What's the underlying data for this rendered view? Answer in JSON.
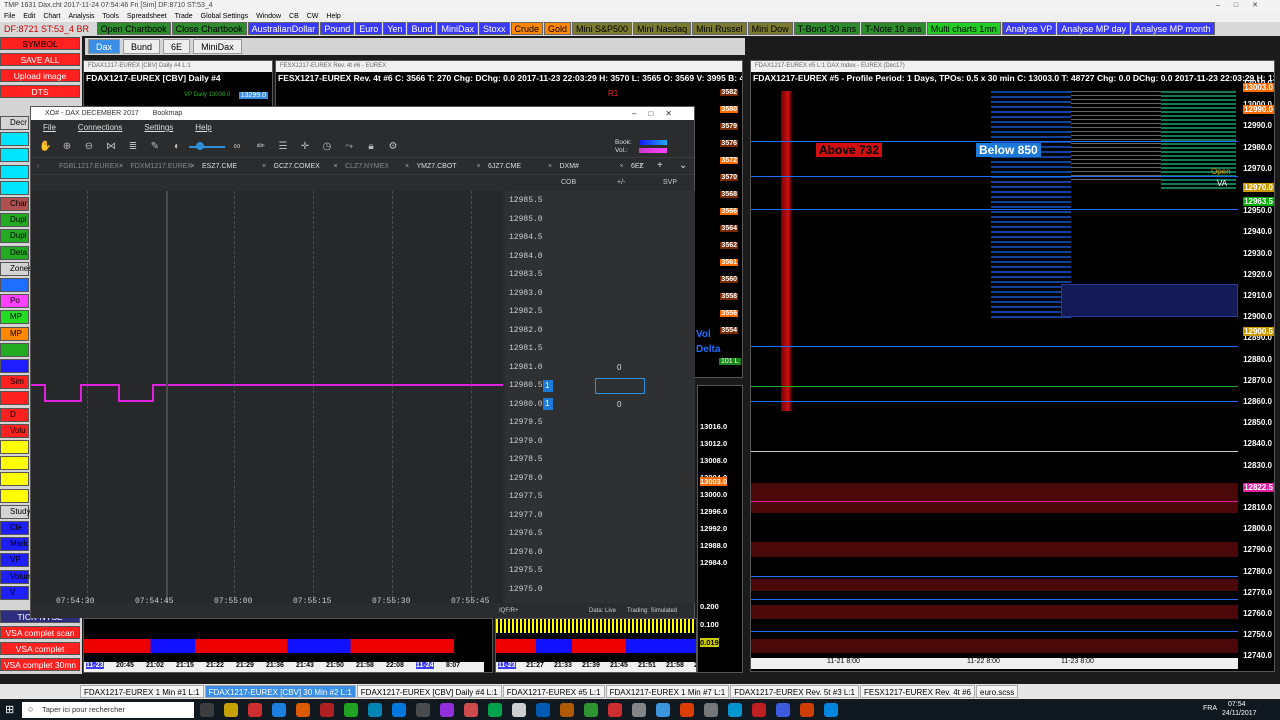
{
  "window": {
    "title": "TMP 1631 Dax.cht  2017-11-24  07:54:46 Fri [Sim]  DF:8710  ST:53_4"
  },
  "menu": [
    "File",
    "Edit",
    "Chart",
    "Analysis",
    "Tools",
    "Spreadsheet",
    "Trade",
    "Global Settings",
    "Window",
    "CB",
    "CW",
    "Help"
  ],
  "status": "DF:8721  ST:53_4  BR",
  "toolbar": [
    {
      "label": "Open Chartbook",
      "bg": "#2e8b2e",
      "fg": "#000"
    },
    {
      "label": "Close Chartbook",
      "bg": "#2e8b2e",
      "fg": "#000"
    },
    {
      "label": "AustralianDollar",
      "bg": "#3a3aff",
      "fg": "#fff"
    },
    {
      "label": "Pound",
      "bg": "#3a3aff",
      "fg": "#fff"
    },
    {
      "label": "Euro",
      "bg": "#3a3aff",
      "fg": "#fff"
    },
    {
      "label": "Yen",
      "bg": "#3a3aff",
      "fg": "#fff"
    },
    {
      "label": "Bund",
      "bg": "#3a3aff",
      "fg": "#fff"
    },
    {
      "label": "MiniDax",
      "bg": "#3a3aff",
      "fg": "#fff"
    },
    {
      "label": "Stoxx",
      "bg": "#3a3aff",
      "fg": "#fff"
    },
    {
      "label": "Crude",
      "bg": "#ff8800",
      "fg": "#000"
    },
    {
      "label": "Gold",
      "bg": "#ff8800",
      "fg": "#000"
    },
    {
      "label": "Mini S&P500",
      "bg": "#7a7a30",
      "fg": "#000"
    },
    {
      "label": "Mini Nasdaq",
      "bg": "#7a7a30",
      "fg": "#000"
    },
    {
      "label": "Mini Russel",
      "bg": "#7a7a30",
      "fg": "#000"
    },
    {
      "label": "Mini Dow",
      "bg": "#7a7a30",
      "fg": "#000"
    },
    {
      "label": "T-Bond 30 ans",
      "bg": "#2e8b2e",
      "fg": "#000"
    },
    {
      "label": "T-Note 10 ans",
      "bg": "#2e8b2e",
      "fg": "#000"
    },
    {
      "label": "Multi charts 1mn",
      "bg": "#22cc22",
      "fg": "#000"
    },
    {
      "label": "Analyse VP",
      "bg": "#3a3aff",
      "fg": "#fff"
    },
    {
      "label": "Analyse MP day",
      "bg": "#3a3aff",
      "fg": "#fff"
    },
    {
      "label": "Analyse MP month",
      "bg": "#3a3aff",
      "fg": "#fff"
    }
  ],
  "sheets": [
    {
      "label": "Dax",
      "selected": true
    },
    {
      "label": "Bund"
    },
    {
      "label": "6E"
    },
    {
      "label": "MiniDax"
    }
  ],
  "left_buttons": [
    {
      "label": "SYMBOL",
      "bg": "#ff2020",
      "fg": "#000"
    },
    {
      "label": "SAVE ALL",
      "bg": "#ff2020",
      "fg": "#fff"
    },
    {
      "label": "Upload image",
      "bg": "#ff2020",
      "fg": "#fff"
    },
    {
      "label": "DTS",
      "bg": "#ff2020",
      "fg": "#fff"
    }
  ],
  "left_strips": [
    {
      "label": "Decr",
      "bg": "#d4d4d4"
    },
    {
      "label": "",
      "bg": "#00e5ff"
    },
    {
      "label": "",
      "bg": "#00e5ff"
    },
    {
      "label": "",
      "bg": "#00e5ff"
    },
    {
      "label": "",
      "bg": "#00e5ff"
    },
    {
      "label": "Char",
      "bg": "#b05050"
    },
    {
      "label": "Dupl",
      "bg": "#22aa22"
    },
    {
      "label": "Dupl",
      "bg": "#22aa22"
    },
    {
      "label": "Deta",
      "bg": "#22aa22"
    },
    {
      "label": "Zones",
      "bg": "#d4d4d4"
    },
    {
      "label": "",
      "bg": "#1e6eff"
    },
    {
      "label": "Po",
      "bg": "#ff40ff"
    },
    {
      "label": "MP",
      "bg": "#22dd22"
    },
    {
      "label": "MP",
      "bg": "#ff8800"
    },
    {
      "label": "",
      "bg": "#22aa22"
    },
    {
      "label": "",
      "bg": "#1e1eff"
    },
    {
      "label": "Sim",
      "bg": "#ff2020"
    },
    {
      "label": "",
      "bg": "#ff2020"
    },
    {
      "label": "D",
      "bg": "#ff2020"
    },
    {
      "label": "Volu",
      "bg": "#ff2020"
    },
    {
      "label": "",
      "bg": "#ffff00"
    },
    {
      "label": "",
      "bg": "#ffff00"
    },
    {
      "label": "",
      "bg": "#ffff00"
    },
    {
      "label": "",
      "bg": "#ffff00"
    },
    {
      "label": "Study",
      "bg": "#d4d4d4"
    },
    {
      "label": "Cle",
      "bg": "#1e1eff"
    },
    {
      "label": "Mark",
      "bg": "#1e1eff"
    },
    {
      "label": "VP",
      "bg": "#1e1eff"
    },
    {
      "label": "Volum",
      "bg": "#1e1eff"
    },
    {
      "label": "V",
      "bg": "#1e1eff"
    }
  ],
  "left_bottom": [
    {
      "label": "TICK-NYSE",
      "bg": "#2e2e80",
      "fg": "#fff"
    },
    {
      "label": "VSA complet scan",
      "bg": "#ff2020",
      "fg": "#fff"
    },
    {
      "label": "VSA complet",
      "bg": "#ff2020",
      "fg": "#fff"
    },
    {
      "label": "VSA complet 30mn",
      "bg": "#ff2020",
      "fg": "#fff"
    }
  ],
  "chart_daily": {
    "title": "FDAX1217-EUREX [CBV]  Daily  #4",
    "tag": "13299.0",
    "vp": "VP Daily 13008.0"
  },
  "chart_fesx": {
    "title": "FESX1217-EUREX  Rev. 4t  #6",
    "values": "C: 3566  T: 270  Chg:  DChg: 0.0  2017-11-23 22:03:29  H: 3570  L: 3565  O: 3569  V: 3995  B: 4",
    "r1": "R1",
    "prices": [
      "3582",
      "3580",
      "3579",
      "3576",
      "3572",
      "3570",
      "3568",
      "3566",
      "3564",
      "3562",
      "3561",
      "3560",
      "3558",
      "3556",
      "3554"
    ],
    "footer": "Delta",
    "vol": "Vol",
    "bid_vol": "101 L"
  },
  "chart_profile": {
    "title": "FDAX1217-EUREX #5 - Profile Period: 1 Days, TPOs: 0.5 x 30 min",
    "values": "C: 13003.0  T: 48727  Chg: 0.0  DChg: 0.0  2017-11-23 22:03:29  H: 13",
    "above": "Above 732",
    "below": "Below 850",
    "open": "Open",
    "va": "VA",
    "prices": [
      "13010.0",
      "13000.0",
      "12990.0",
      "12980.0",
      "12970.0",
      "12960.0",
      "12950.0",
      "12940.0",
      "12930.0",
      "12920.0",
      "12910.0",
      "12900.0",
      "12890.0",
      "12880.0",
      "12870.0",
      "12860.0",
      "12850.0",
      "12840.0",
      "12830.0",
      "12820.0",
      "12810.0",
      "12800.0",
      "12790.0",
      "12780.0",
      "12770.0",
      "12760.0",
      "12750.0",
      "12740.0"
    ],
    "tags": [
      "13003.0",
      "12990.0",
      "12970.0",
      "12963.5",
      "12900.5",
      "12822.5"
    ],
    "dates": [
      "11-21  8:00",
      "11-22  8:00",
      "11-23  8:00"
    ]
  },
  "chart_1min": {
    "prices": [
      "13016.0",
      "13012.0",
      "13008.0",
      "13004.0",
      "13000.0",
      "12996.0",
      "12992.0",
      "12988.0",
      "12984.0"
    ],
    "tag": "13003.0",
    "osc": [
      "0.200",
      "0.100",
      "0.019"
    ]
  },
  "chart_30min": {
    "dates": [
      "11-23",
      "20:45",
      "21:02",
      "21:15",
      "21:22",
      "21:29",
      "21:36",
      "21:43",
      "21:50",
      "21:58",
      "22:08",
      "11-24",
      "8:07"
    ]
  },
  "chart_fesx_dates": [
    "11-23",
    "21:27",
    "21:33",
    "21:39",
    "21:45",
    "21:51",
    "21:58",
    "22:07"
  ],
  "bookmap": {
    "title": "XO# - DAX DECEMBER 2017",
    "subtitle": "Bookmap",
    "menu": [
      "File",
      "Connections",
      "Settings",
      "Help"
    ],
    "tabs": [
      "FGBL1217.EUREX",
      "FDXM1217.EUREX",
      "ESZ7.CME",
      "GCZ7.COMEX",
      "CLZ7.NYMEX",
      "YMZ7.CBOT",
      "6JZ7.CME",
      "DXM#",
      "6EZ"
    ],
    "book_label": "Book:",
    "vol_label": "Vol.:",
    "cols": [
      "COB",
      "+/-",
      "SVP"
    ],
    "prices": [
      "12985.5",
      "12985.0",
      "12984.5",
      "12984.0",
      "12983.5",
      "12983.0",
      "12982.5",
      "12982.0",
      "12981.5",
      "12981.0",
      "12980.5",
      "12980.0",
      "12979.5",
      "12979.0",
      "12978.5",
      "12978.0",
      "12977.5",
      "12977.0",
      "12976.5",
      "12976.0",
      "12975.5",
      "12975.0"
    ],
    "bid_qty": "1",
    "ask_qty": "1",
    "plus_top": "0",
    "plus_bot": "0",
    "times": [
      "07:54:30",
      "07:54:45",
      "07:55:00",
      "07:55:15",
      "07:55:30",
      "07:55:45"
    ],
    "footer_left": "IQF/R+",
    "data": "Data: Live",
    "trading": "Trading: Simulated"
  },
  "taskbar_tabs": [
    {
      "label": "FDAX1217-EUREX  1 Min  #1  L:1"
    },
    {
      "label": "FDAX1217-EUREX [CBV]  30 Min  #2  L:1",
      "selected": true
    },
    {
      "label": "FDAX1217-EUREX [CBV]  Daily  #4  L:1"
    },
    {
      "label": "FDAX1217-EUREX  #5  L:1"
    },
    {
      "label": "FDAX1217-EUREX  1 Min  #7  L:1"
    },
    {
      "label": "FDAX1217-EUREX  Rev. 5t  #3  L:1"
    },
    {
      "label": "FESX1217-EUREX  Rev. 4t  #6"
    },
    {
      "label": "euro.scss"
    }
  ],
  "windows": {
    "search": "Taper ici pour rechercher",
    "lang": "FRA",
    "time": "07:54",
    "date": "24/11/2017"
  }
}
